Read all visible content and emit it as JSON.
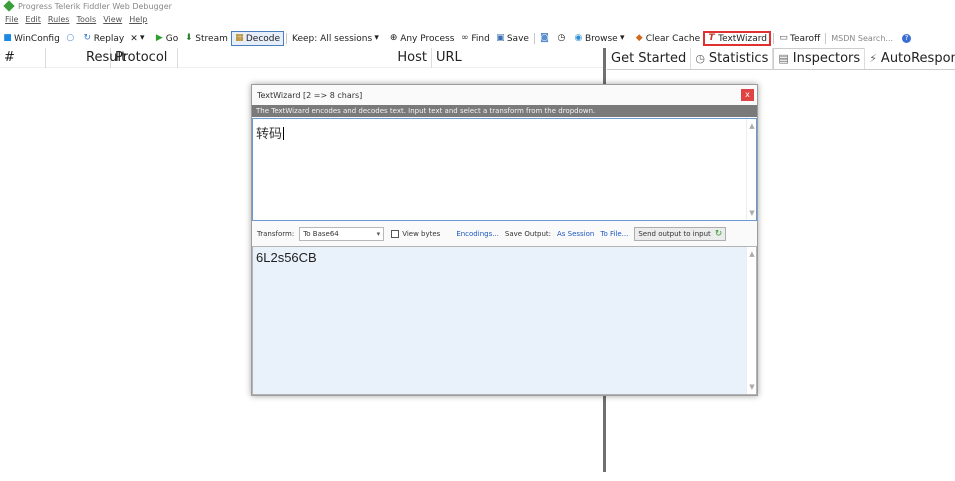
{
  "window": {
    "title": "Progress Telerik Fiddler Web Debugger"
  },
  "menu": [
    "File",
    "Edit",
    "Rules",
    "Tools",
    "View",
    "Help"
  ],
  "toolbar": {
    "winconfig": "WinConfig",
    "replay": "Replay",
    "remove": "✕",
    "go": "Go",
    "stream": "Stream",
    "decode": "Decode",
    "keep": "Keep: All sessions",
    "any_process": "Any Process",
    "find": "Find",
    "save": "Save",
    "browse": "Browse",
    "clear_cache": "Clear Cache",
    "textwizard": "TextWizard",
    "tearoff": "Tearoff",
    "msdn_search": "MSDN Search..."
  },
  "grid": {
    "columns": [
      "#",
      "Result",
      "Protocol",
      "Host",
      "URL"
    ]
  },
  "tabs": [
    "Get Started",
    "Statistics",
    "Inspectors",
    "AutoResponder"
  ],
  "dialog": {
    "title": "TextWizard [2 => 8 chars]",
    "close": "x",
    "info": "The TextWizard encodes and decodes text. Input text and select a transform from the dropdown.",
    "input_text": "转码",
    "transform_label": "Transform:",
    "transform_value": "To Base64",
    "view_bytes": "View bytes",
    "encodings": "Encodings...",
    "save_output_label": "Save Output:",
    "as_session": "As Session",
    "to_file": "To File...",
    "send_output": "Send output to input",
    "output_text": "6L2s56CB"
  },
  "colors": {
    "textwizard_highlight": "#e03030",
    "info_bar": "#7a7a7a",
    "output_bg": "#e9f2fb",
    "link": "#1b57c0"
  }
}
